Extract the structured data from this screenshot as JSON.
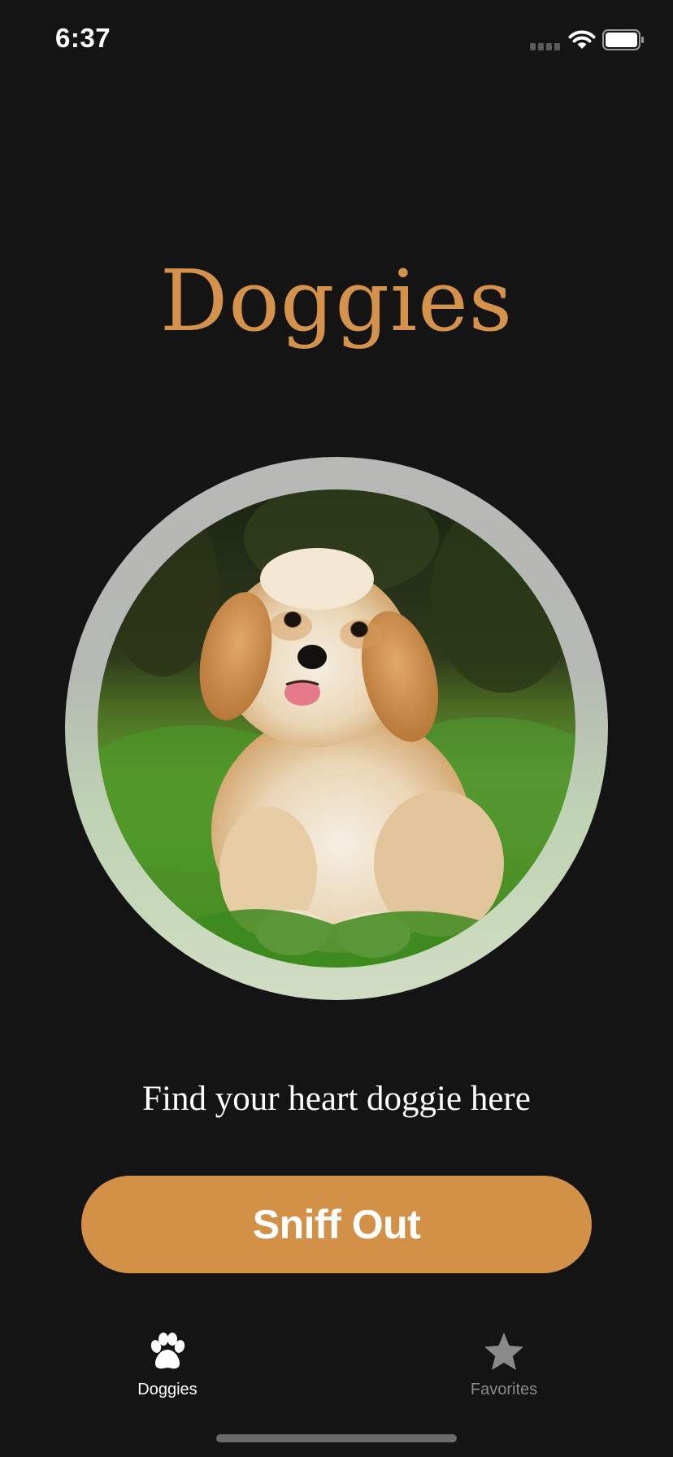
{
  "status_bar": {
    "time": "6:37",
    "icons": [
      "signal-icon",
      "wifi-icon",
      "battery-icon"
    ]
  },
  "header": {
    "title": "Doggies"
  },
  "hero": {
    "image": "puppy-photo",
    "alt": "Fluffy cream and tan puppy sitting on grass"
  },
  "tagline": "Find your heart doggie here",
  "action_button": {
    "label": "Sniff Out"
  },
  "tab_bar": {
    "tabs": [
      {
        "label": "Doggies",
        "icon": "paw-icon",
        "selected": true
      },
      {
        "label": "Favorites",
        "icon": "star-icon",
        "selected": false
      }
    ]
  },
  "colors": {
    "background": "#141414",
    "accent": "#d39148",
    "title": "#d4924a",
    "tab_active": "#ffffff",
    "tab_inactive": "#8a8a8a"
  }
}
